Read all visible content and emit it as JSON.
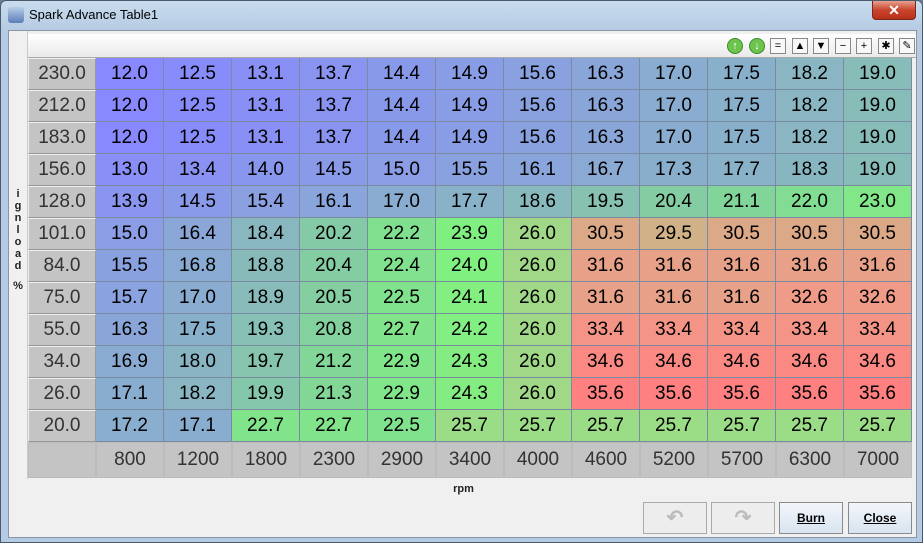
{
  "window": {
    "title": "Spark Advance Table1",
    "close_glyph": "✕"
  },
  "toolbar": [
    {
      "name": "go-up-icon",
      "glyph": "↑",
      "round": true
    },
    {
      "name": "go-down-icon",
      "glyph": "↓",
      "round": true
    },
    {
      "name": "set-equal-icon",
      "glyph": "="
    },
    {
      "name": "increase-icon",
      "glyph": "▲"
    },
    {
      "name": "decrease-icon",
      "glyph": "▼"
    },
    {
      "name": "minus-icon",
      "glyph": "−"
    },
    {
      "name": "plus-icon",
      "glyph": "+"
    },
    {
      "name": "multiply-icon",
      "glyph": "✱"
    },
    {
      "name": "interpolate-pen-icon",
      "glyph": "✎"
    }
  ],
  "y_axis": {
    "label": "ignload%",
    "label_chars": [
      "i",
      "g",
      "n",
      "l",
      "o",
      "a",
      "d",
      "",
      "%"
    ],
    "values": [
      "230.0",
      "212.0",
      "183.0",
      "156.0",
      "128.0",
      "101.0",
      "84.0",
      "75.0",
      "55.0",
      "34.0",
      "26.0",
      "20.0"
    ]
  },
  "x_axis": {
    "label": "rpm",
    "values": [
      "800",
      "1200",
      "1800",
      "2300",
      "2900",
      "3400",
      "4000",
      "4600",
      "5200",
      "5700",
      "6300",
      "7000"
    ]
  },
  "table": [
    [
      "12.0",
      "12.5",
      "13.1",
      "13.7",
      "14.4",
      "14.9",
      "15.6",
      "16.3",
      "17.0",
      "17.5",
      "18.2",
      "19.0"
    ],
    [
      "12.0",
      "12.5",
      "13.1",
      "13.7",
      "14.4",
      "14.9",
      "15.6",
      "16.3",
      "17.0",
      "17.5",
      "18.2",
      "19.0"
    ],
    [
      "12.0",
      "12.5",
      "13.1",
      "13.7",
      "14.4",
      "14.9",
      "15.6",
      "16.3",
      "17.0",
      "17.5",
      "18.2",
      "19.0"
    ],
    [
      "13.0",
      "13.4",
      "14.0",
      "14.5",
      "15.0",
      "15.5",
      "16.1",
      "16.7",
      "17.3",
      "17.7",
      "18.3",
      "19.0"
    ],
    [
      "13.9",
      "14.5",
      "15.4",
      "16.1",
      "17.0",
      "17.7",
      "18.6",
      "19.5",
      "20.4",
      "21.1",
      "22.0",
      "23.0"
    ],
    [
      "15.0",
      "16.4",
      "18.4",
      "20.2",
      "22.2",
      "23.9",
      "26.0",
      "30.5",
      "29.5",
      "30.5",
      "30.5",
      "30.5"
    ],
    [
      "15.5",
      "16.8",
      "18.8",
      "20.4",
      "22.4",
      "24.0",
      "26.0",
      "31.6",
      "31.6",
      "31.6",
      "31.6",
      "31.6"
    ],
    [
      "15.7",
      "17.0",
      "18.9",
      "20.5",
      "22.5",
      "24.1",
      "26.0",
      "31.6",
      "31.6",
      "31.6",
      "32.6",
      "32.6"
    ],
    [
      "16.3",
      "17.5",
      "19.3",
      "20.8",
      "22.7",
      "24.2",
      "26.0",
      "33.4",
      "33.4",
      "33.4",
      "33.4",
      "33.4"
    ],
    [
      "16.9",
      "18.0",
      "19.7",
      "21.2",
      "22.9",
      "24.3",
      "26.0",
      "34.6",
      "34.6",
      "34.6",
      "34.6",
      "34.6"
    ],
    [
      "17.1",
      "18.2",
      "19.9",
      "21.3",
      "22.9",
      "24.3",
      "26.0",
      "35.6",
      "35.6",
      "35.6",
      "35.6",
      "35.6"
    ],
    [
      "17.2",
      "17.1",
      "22.7",
      "22.7",
      "22.5",
      "25.7",
      "25.7",
      "25.7",
      "25.7",
      "25.7",
      "25.7",
      "25.7"
    ]
  ],
  "color_scale": [
    [
      12,
      "#8888ff"
    ],
    [
      16,
      "#8aa4dc"
    ],
    [
      19,
      "#88bcb8"
    ],
    [
      21,
      "#82d49a"
    ],
    [
      24,
      "#80f080"
    ],
    [
      26,
      "#a0d888"
    ],
    [
      30,
      "#d8ac88"
    ],
    [
      33,
      "#f29888"
    ],
    [
      35.6,
      "#ff8080"
    ]
  ],
  "buttons": {
    "undo": "↶",
    "redo": "↷",
    "burn": "Burn",
    "close": "Close"
  }
}
